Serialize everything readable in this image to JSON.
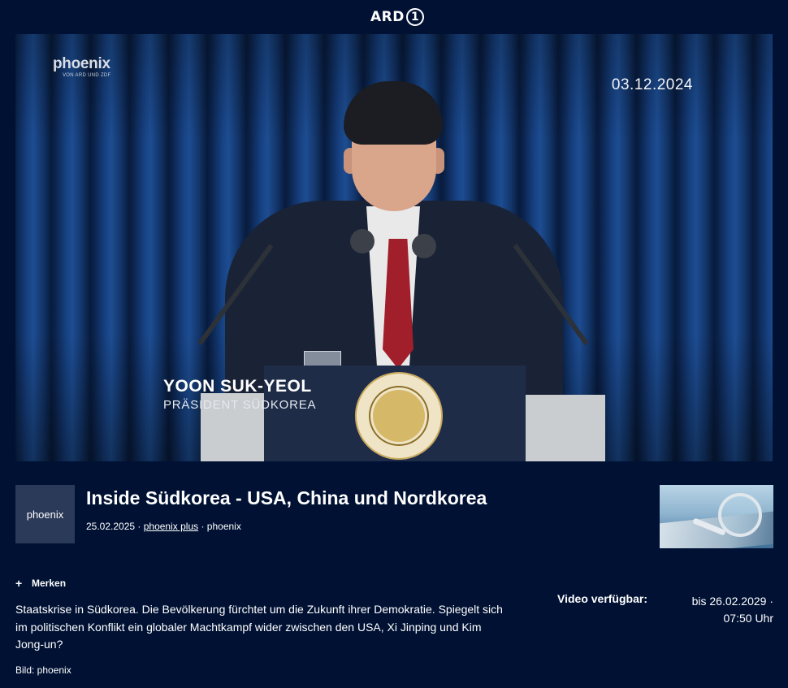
{
  "header": {
    "brand": "ARD",
    "brand_mark": "1"
  },
  "video": {
    "channel_logo": "phoenix",
    "channel_logo_sub": "VON ARD UND ZDF",
    "date_overlay": "03.12.2024",
    "lower_third_name": "YOON SUK-YEOL",
    "lower_third_role": "PRÄSIDENT SÜDKOREA"
  },
  "show": {
    "logo_text": "phoenix",
    "title": "Inside Südkorea - USA, China und Nordkorea",
    "date": "25.02.2025",
    "sep": " · ",
    "series_link": "phoenix plus",
    "broadcaster": "phoenix"
  },
  "actions": {
    "merken_label": "Merken"
  },
  "description": "Staatskrise in Südkorea. Die Bevölkerung fürchtet um die Zukunft ihrer Demokratie. Spiegelt sich im politischen Konflikt ein globaler Machtkampf wider zwischen den USA, Xi Jinping und Kim Jong-un?",
  "image_credit": "Bild: phoenix",
  "availability": {
    "label": "Video verfügbar:",
    "line1": "bis 26.02.2029 ·",
    "line2": "07:50 Uhr"
  },
  "icons": {
    "plus": "plus-icon",
    "brand": "ard-one-icon"
  }
}
